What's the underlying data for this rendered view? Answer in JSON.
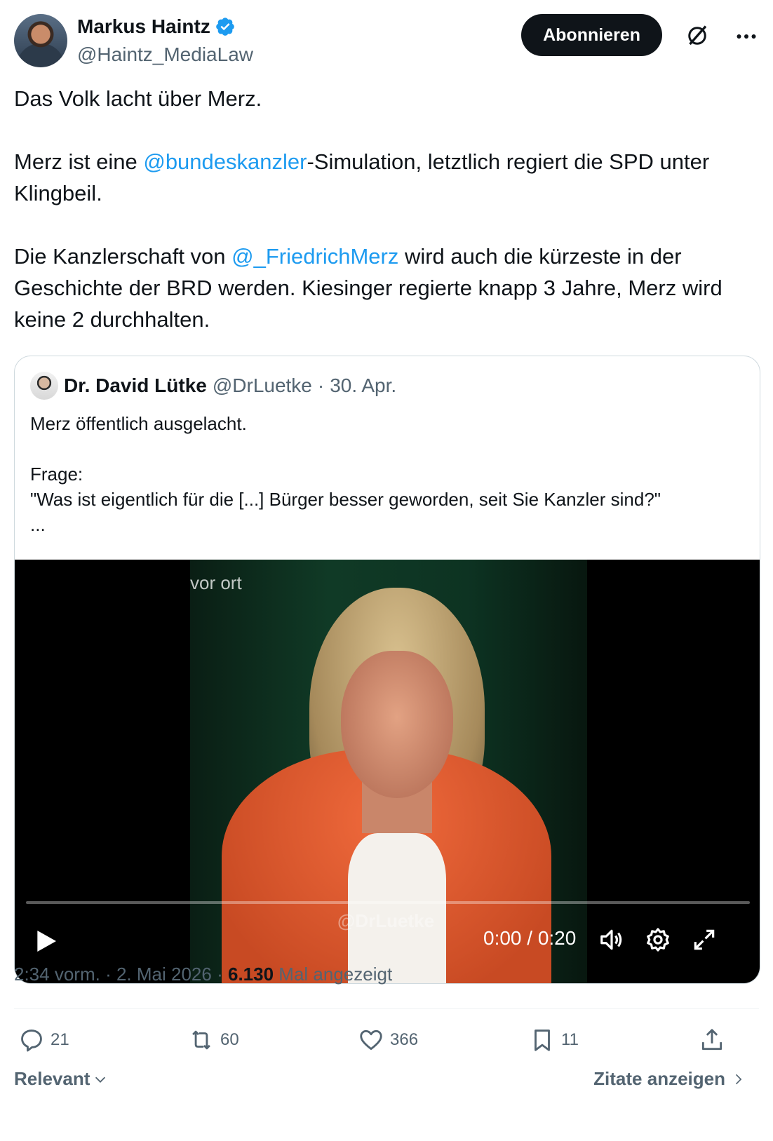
{
  "author": {
    "display_name": "Markus Haintz",
    "handle": "@Haintz_MediaLaw",
    "follow_label": "Abonnieren"
  },
  "tweet": {
    "p1": "Das Volk lacht über Merz.",
    "p2_pre": "Merz ist eine ",
    "p2_mention": "@bundeskanzler",
    "p2_post": "-Simulation, letztlich regiert die SPD unter Klingbeil.",
    "p3_pre": "Die Kanzlerschaft von ",
    "p3_mention": "@_FriedrichMerz",
    "p3_post": " wird auch die kürzeste in der Geschichte der BRD werden. Kiesinger regierte knapp 3 Jahre, Merz wird keine 2 durchhalten."
  },
  "quote": {
    "name": "Dr. David Lütke",
    "handle": "@DrLuetke",
    "separator": "·",
    "date": "30. Apr.",
    "line1": "Merz öffentlich ausgelacht.",
    "line2": "Frage:",
    "line3": "\"Was ist eigentlich für die [...] Bürger besser geworden, seit Sie Kanzler sind?\"",
    "line4": "..."
  },
  "video": {
    "watermark_top": "vor ort",
    "watermark_bottom": "@DrLuetke",
    "time": "0:00 / 0:20",
    "progress": 0.0
  },
  "meta": {
    "time": "2:34 vorm.",
    "sep1": "·",
    "date": "2. Mai 2026",
    "sep2": "·",
    "views": "6.130",
    "views_label": "Mal angezeigt"
  },
  "actions": {
    "replies": "21",
    "reposts": "60",
    "likes": "366",
    "bookmarks": "11"
  },
  "footer": {
    "sort_label": "Relevant",
    "quotes_label": "Zitate anzeigen"
  },
  "colors": {
    "link": "#1d9bf0",
    "muted": "#536471",
    "text": "#0f1419",
    "verified": "#1d9bf0"
  }
}
